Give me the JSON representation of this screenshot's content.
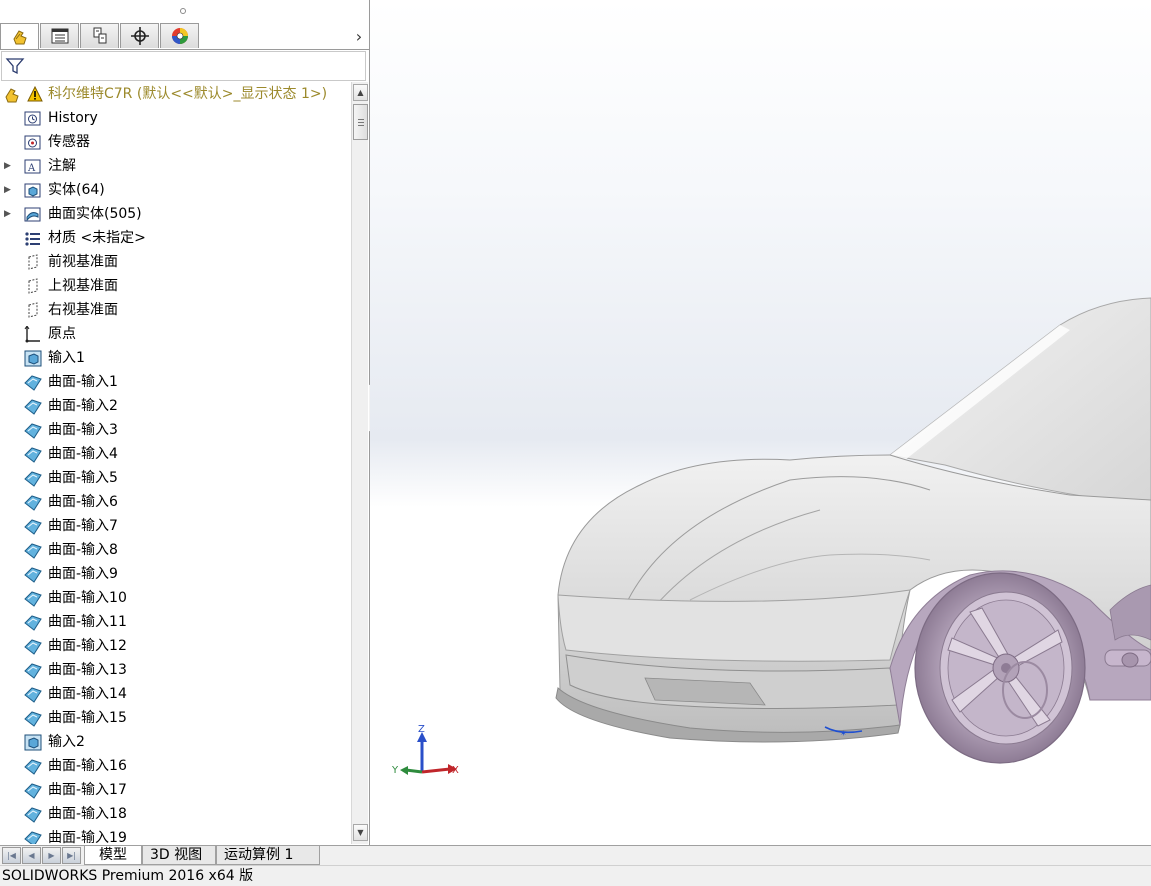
{
  "feature_manager": {
    "tabs": [
      {
        "icon": "feature-manager-icon",
        "active": true
      },
      {
        "icon": "property-manager-icon"
      },
      {
        "icon": "configuration-manager-icon"
      },
      {
        "icon": "dimxpert-manager-icon"
      },
      {
        "icon": "display-manager-icon"
      }
    ],
    "filter_icon": "filter-icon",
    "root": {
      "label": "科尔维特C7R  (默认<<默认>_显示状态 1>)",
      "icon": "part-icon",
      "status_icon": "warning-icon",
      "color": "#9c8a2c"
    },
    "items": [
      {
        "label": "History",
        "icon": "history-icon"
      },
      {
        "label": "传感器",
        "icon": "sensor-icon"
      },
      {
        "label": "注解",
        "icon": "annotation-icon",
        "expandable": true
      },
      {
        "label": "实体(64)",
        "icon": "solid-bodies-icon",
        "expandable": true
      },
      {
        "label": "曲面实体(505)",
        "icon": "surface-bodies-icon",
        "expandable": true
      },
      {
        "label": "材质 <未指定>",
        "icon": "material-icon"
      },
      {
        "label": "前视基准面",
        "icon": "plane-icon"
      },
      {
        "label": "上视基准面",
        "icon": "plane-icon"
      },
      {
        "label": "右视基准面",
        "icon": "plane-icon"
      },
      {
        "label": "原点",
        "icon": "origin-icon"
      },
      {
        "label": "输入1",
        "icon": "imported-body-icon"
      },
      {
        "label": "曲面-输入1",
        "icon": "imported-surface-icon"
      },
      {
        "label": "曲面-输入2",
        "icon": "imported-surface-icon"
      },
      {
        "label": "曲面-输入3",
        "icon": "imported-surface-icon"
      },
      {
        "label": "曲面-输入4",
        "icon": "imported-surface-icon"
      },
      {
        "label": "曲面-输入5",
        "icon": "imported-surface-icon"
      },
      {
        "label": "曲面-输入6",
        "icon": "imported-surface-icon"
      },
      {
        "label": "曲面-输入7",
        "icon": "imported-surface-icon"
      },
      {
        "label": "曲面-输入8",
        "icon": "imported-surface-icon"
      },
      {
        "label": "曲面-输入9",
        "icon": "imported-surface-icon"
      },
      {
        "label": "曲面-输入10",
        "icon": "imported-surface-icon"
      },
      {
        "label": "曲面-输入11",
        "icon": "imported-surface-icon"
      },
      {
        "label": "曲面-输入12",
        "icon": "imported-surface-icon"
      },
      {
        "label": "曲面-输入13",
        "icon": "imported-surface-icon"
      },
      {
        "label": "曲面-输入14",
        "icon": "imported-surface-icon"
      },
      {
        "label": "曲面-输入15",
        "icon": "imported-surface-icon"
      },
      {
        "label": "输入2",
        "icon": "imported-body-icon"
      },
      {
        "label": "曲面-输入16",
        "icon": "imported-surface-icon"
      },
      {
        "label": "曲面-输入17",
        "icon": "imported-surface-icon"
      },
      {
        "label": "曲面-输入18",
        "icon": "imported-surface-icon"
      },
      {
        "label": "曲面-输入19",
        "icon": "imported-surface-icon"
      }
    ]
  },
  "viewport": {
    "triad": {
      "x_label": "X",
      "y_label": "Y",
      "z_label": "Z",
      "x_color": "#c0262b",
      "y_color": "#2e8b3d",
      "z_color": "#2a4fc9"
    }
  },
  "bottom_tabs": [
    {
      "label": "模型",
      "active": true
    },
    {
      "label": "3D 视图"
    },
    {
      "label": "运动算例 1"
    }
  ],
  "status_bar": {
    "text": "SOLIDWORKS Premium 2016 x64 版"
  }
}
